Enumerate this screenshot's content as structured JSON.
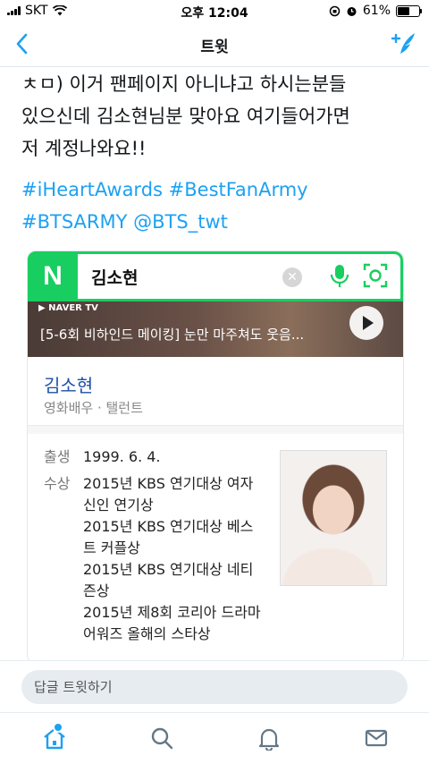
{
  "status_bar": {
    "carrier": "SKT",
    "time": "오후 12:04",
    "battery_text": "61%",
    "battery_level": 0.61
  },
  "nav": {
    "title": "트윗",
    "back_icon": "chevron-left-icon",
    "compose_icon": "compose-tweet-icon"
  },
  "tweet": {
    "text": "ㅊㅁ) 이거 팬페이지 아니냐고 하시는분들\n있으신데 김소현님분 맞아요 여기들어가면\n저 계정나와요!!",
    "hashtags": [
      "#iHeartAwards",
      "#BestFanArmy",
      "#BTSARMY",
      "@BTS_twt"
    ]
  },
  "media": {
    "search": {
      "logo": "N",
      "query": "김소현",
      "clear_icon": "clear-icon",
      "mic_icon": "mic-icon",
      "lens_icon": "lens-icon"
    },
    "video": {
      "badge": "▶ NAVER TV",
      "title": "[5-6회 비하인드 메이킹] 눈만 마주쳐도 웃음...",
      "play_icon": "play-icon"
    },
    "profile": {
      "name": "김소현",
      "subtitle": "영화배우 · 탤런트"
    },
    "info": {
      "birth_label": "출생",
      "birth_value": "1999. 6. 4.",
      "award_label": "수상",
      "awards": [
        "2015년 KBS 연기대상 여자 신인 연기상",
        "2015년 KBS 연기대상 베스트 커플상",
        "2015년 KBS 연기대상 네티즌상",
        "2015년 제8회 코리아 드라마 어워즈 올해의 스타상"
      ]
    }
  },
  "reply": {
    "placeholder": "답글 트윗하기"
  },
  "tabs": {
    "items": [
      "home-icon",
      "search-icon",
      "notifications-icon",
      "messages-icon"
    ]
  },
  "colors": {
    "twitter_blue": "#1da1f2",
    "naver_green": "#19ce60"
  }
}
